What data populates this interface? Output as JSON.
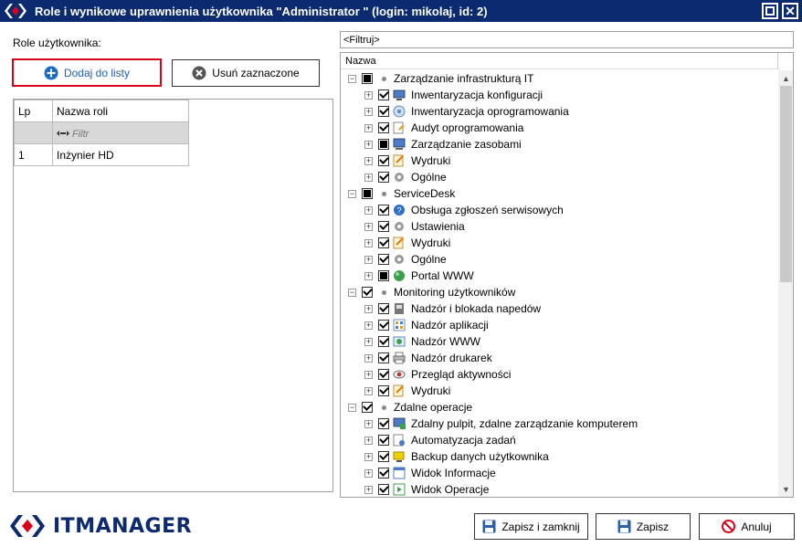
{
  "window": {
    "title": "Role i wynikowe uprawnienia użytkownika \"Administrator \" (login: mikolaj, id: 2)",
    "maximize_label": "",
    "close_label": "✕"
  },
  "roles": {
    "label": "Role użytkownika:",
    "add_button": "Dodaj do listy",
    "remove_button": "Usuń zaznaczone",
    "columns": {
      "lp": "Lp",
      "name": "Nazwa roli"
    },
    "filter_placeholder": "Filtr",
    "rows": [
      {
        "lp": "1",
        "name": "Inżynier HD"
      }
    ]
  },
  "tree": {
    "filter_text": "<Filtruj>",
    "column": "Nazwa",
    "rows": [
      {
        "level": 0,
        "state": "partial",
        "icon": "dot",
        "label": "Zarządzanie infrastrukturą IT"
      },
      {
        "level": 1,
        "state": "checked",
        "icon": "computer-config-icon",
        "label": "Inwentaryzacja konfiguracji"
      },
      {
        "level": 1,
        "state": "checked",
        "icon": "software-icon",
        "label": "Inwentaryzacja oprogramowania"
      },
      {
        "level": 1,
        "state": "checked",
        "icon": "audit-icon",
        "label": "Audyt oprogramowania"
      },
      {
        "level": 1,
        "state": "partial",
        "icon": "assets-icon",
        "label": "Zarządzanie zasobami"
      },
      {
        "level": 1,
        "state": "checked",
        "icon": "report-icon",
        "label": "Wydruki"
      },
      {
        "level": 1,
        "state": "checked",
        "icon": "gear-icon",
        "label": "Ogólne"
      },
      {
        "level": 0,
        "state": "partial",
        "icon": "dot",
        "label": "ServiceDesk"
      },
      {
        "level": 1,
        "state": "checked",
        "icon": "help-icon",
        "label": "Obsługa zgłoszeń serwisowych"
      },
      {
        "level": 1,
        "state": "checked",
        "icon": "gear-icon",
        "label": "Ustawienia"
      },
      {
        "level": 1,
        "state": "checked",
        "icon": "report-icon",
        "label": "Wydruki"
      },
      {
        "level": 1,
        "state": "checked",
        "icon": "gear-icon",
        "label": "Ogólne"
      },
      {
        "level": 1,
        "state": "partial",
        "icon": "globe-icon",
        "label": "Portal WWW"
      },
      {
        "level": 0,
        "state": "checked",
        "icon": "dot",
        "label": "Monitoring użytkowników"
      },
      {
        "level": 1,
        "state": "checked",
        "icon": "drive-lock-icon",
        "label": "Nadzór i blokada napedów"
      },
      {
        "level": 1,
        "state": "checked",
        "icon": "apps-icon",
        "label": "Nadzór aplikacji"
      },
      {
        "level": 1,
        "state": "checked",
        "icon": "web-icon",
        "label": "Nadzór WWW"
      },
      {
        "level": 1,
        "state": "checked",
        "icon": "printer-icon",
        "label": "Nadzór drukarek"
      },
      {
        "level": 1,
        "state": "checked",
        "icon": "eye-icon",
        "label": "Przegląd aktywności"
      },
      {
        "level": 1,
        "state": "checked",
        "icon": "report-icon",
        "label": "Wydruki"
      },
      {
        "level": 0,
        "state": "checked",
        "icon": "dot",
        "label": "Zdalne operacje"
      },
      {
        "level": 1,
        "state": "checked",
        "icon": "remote-desktop-icon",
        "label": "Zdalny pulpit, zdalne zarządzanie komputerem"
      },
      {
        "level": 1,
        "state": "checked",
        "icon": "automation-icon",
        "label": "Automatyzacja zadań"
      },
      {
        "level": 1,
        "state": "checked",
        "icon": "backup-icon",
        "label": "Backup danych użytkownika"
      },
      {
        "level": 1,
        "state": "checked",
        "icon": "window-info-icon",
        "label": "Widok Informacje"
      },
      {
        "level": 1,
        "state": "checked",
        "icon": "window-ops-icon",
        "label": "Widok Operacje"
      }
    ]
  },
  "footer": {
    "logo_text": "ITMANAGER",
    "save_close": "Zapisz i zamknij",
    "save": "Zapisz",
    "cancel": "Anuluj"
  },
  "colors": {
    "titlebar": "#0b2a70",
    "accent_red": "#d9001b",
    "link_blue": "#1e5fb8"
  }
}
